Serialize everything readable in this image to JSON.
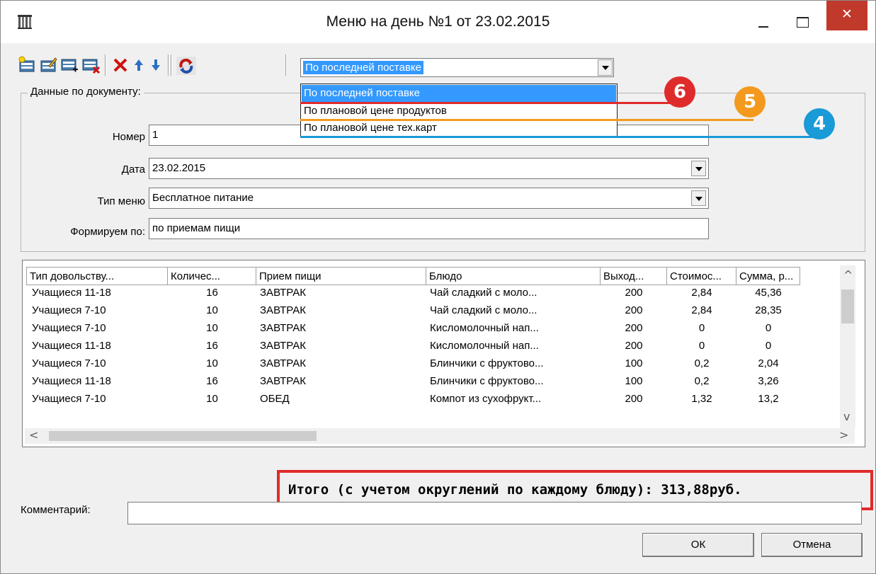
{
  "window": {
    "title": "Меню на день №1 от 23.02.2015",
    "close_glyph": "✕"
  },
  "toolbar": {
    "icons": [
      "add-record-icon",
      "edit-record-icon",
      "insert-row-icon",
      "delete-row-icon",
      "delete-icon",
      "move-up-icon",
      "move-down-icon",
      "refresh-icon"
    ],
    "price_mode": {
      "selected": "По последней поставке",
      "options": [
        "По последней поставке",
        "По плановой цене продуктов",
        "По плановой цене тех.карт"
      ]
    }
  },
  "doc": {
    "group_label": "Данные по документу:",
    "number_label": "Номер",
    "number": "1",
    "date_label": "Дата",
    "date": "23.02.2015",
    "menu_type_label": "Тип меню",
    "menu_type": "Бесплатное питание",
    "form_by_label": "Формируем по:",
    "form_by": "по приемам пищи"
  },
  "table": {
    "columns": [
      "Тип довольству...",
      "Количес...",
      "Прием пищи",
      "Блюдо",
      "Выход...",
      "Стоимос...",
      "Сумма, р..."
    ],
    "rows": [
      [
        "Учащиеся 11-18",
        "16",
        "ЗАВТРАК",
        "Чай сладкий с моло...",
        "200",
        "2,84",
        "45,36"
      ],
      [
        "Учащиеся 7-10",
        "10",
        "ЗАВТРАК",
        "Чай сладкий с моло...",
        "200",
        "2,84",
        "28,35"
      ],
      [
        "Учащиеся 7-10",
        "10",
        "ЗАВТРАК",
        "Кисломолочный нап...",
        "200",
        "0",
        "0"
      ],
      [
        "Учащиеся 11-18",
        "16",
        "ЗАВТРАК",
        "Кисломолочный нап...",
        "200",
        "0",
        "0"
      ],
      [
        "Учащиеся 7-10",
        "10",
        "ЗАВТРАК",
        "Блинчики с фруктово...",
        "100",
        "0,2",
        "2,04"
      ],
      [
        "Учащиеся 11-18",
        "16",
        "ЗАВТРАК",
        "Блинчики с фруктово...",
        "100",
        "0,2",
        "3,26"
      ],
      [
        "Учащиеся 7-10",
        "10",
        "ОБЕД",
        "Компот из сухофрукт...",
        "200",
        "1,32",
        "13,2"
      ]
    ]
  },
  "total": "Итого (с учетом округлений по каждому блюду): 313,88руб.",
  "comment_label": "Комментарий:",
  "buttons": {
    "ok": "ОК",
    "cancel": "Отмена"
  },
  "markers": [
    {
      "label": "6",
      "color": "#e02b2b"
    },
    {
      "label": "5",
      "color": "#f39a1e"
    },
    {
      "label": "4",
      "color": "#1a9ad6"
    }
  ]
}
